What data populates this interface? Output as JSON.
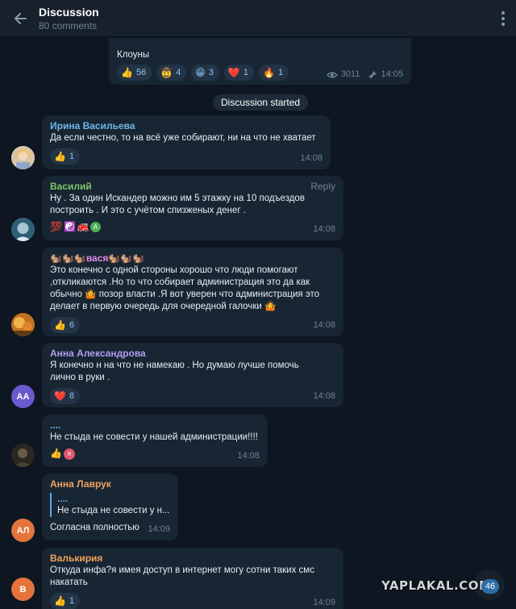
{
  "header": {
    "title": "Discussion",
    "subtitle": "80 comments"
  },
  "post": {
    "text": "Клоуны",
    "reactions": [
      {
        "emoji": "👍",
        "count": "56"
      },
      {
        "emoji": "🤠",
        "count": "4"
      },
      {
        "emoji": "😁",
        "count": "3"
      },
      {
        "emoji": "❤️",
        "count": "1"
      },
      {
        "emoji": "🔥",
        "count": "1"
      }
    ],
    "views": "3011",
    "time": "14:05"
  },
  "date_pill": "Discussion started",
  "messages": [
    {
      "author": "Ирина Васильева",
      "author_color": "#6fb7ea",
      "text": "Да если честно,  то на всё уже собирают, ни на что не хватает",
      "reactions": [
        {
          "emoji": "👍",
          "count": "1"
        }
      ],
      "time": "14:08"
    },
    {
      "author": "Василий",
      "author_color": "#7cc66b",
      "text": "Ну . За один Искандер можно им 5 этажку на 10 подъездов\nпостроить . И это с учётом спизженых денег .",
      "reply_label": "Reply",
      "reaction_emojis": [
        "💯",
        "☯️",
        "🚒"
      ],
      "reaction_avatar": "A",
      "time": "14:08"
    },
    {
      "author": "🐿️🐿️🐿️вася🐿️🐿️🐿️",
      "author_color": "#e38ae6",
      "text": "Это конечно с одной стороны хорошо что люди помогают\n,откликаются .Но то что собирает администрация это да как\nобычно 🤷 позор власти .Я вот уверен что администрация это\nделает в первую очередь для очередной галочки 🤷",
      "reactions": [
        {
          "emoji": "👍",
          "count": "6"
        }
      ],
      "time": "14:08"
    },
    {
      "author": "Анна Александрова",
      "author_color": "#b59cf0",
      "text": "Я конечно н на что не намекаю . Но думаю лучше помочь\nлично в руки .",
      "reactions": [
        {
          "emoji": "❤️",
          "count": "8"
        }
      ],
      "time": "14:08",
      "avatar_initials": "АА"
    },
    {
      "author": "....",
      "author_color": "#6fb7ea",
      "text": "Не стыда не совести у нашей администрации!!!!",
      "reaction_emojis": [
        "👍"
      ],
      "reaction_avatar": "я",
      "time": "14:08"
    },
    {
      "author": "Анна Лаврук",
      "author_color": "#f0a35e",
      "quote_author": "....",
      "quote_text": "Не стыда не совести у н...",
      "text": "Согласна полностью",
      "time": "14:09",
      "avatar_initials": "АЛ"
    },
    {
      "author": "Валькирия",
      "author_color": "#f0a35e",
      "text": "Откуда инфа?я имея доступ в интернет могу сотни таких смс\nнакатать",
      "reactions": [
        {
          "emoji": "👍",
          "count": "1"
        }
      ],
      "time": "14:09",
      "avatar_initials": "В"
    }
  ],
  "unread_count": "46",
  "watermark": "YAPLAKAL.COM",
  "colors": {
    "background": "#0e1621",
    "bubble": "#182533",
    "header": "#17212b",
    "accent": "#5ea8e6"
  }
}
